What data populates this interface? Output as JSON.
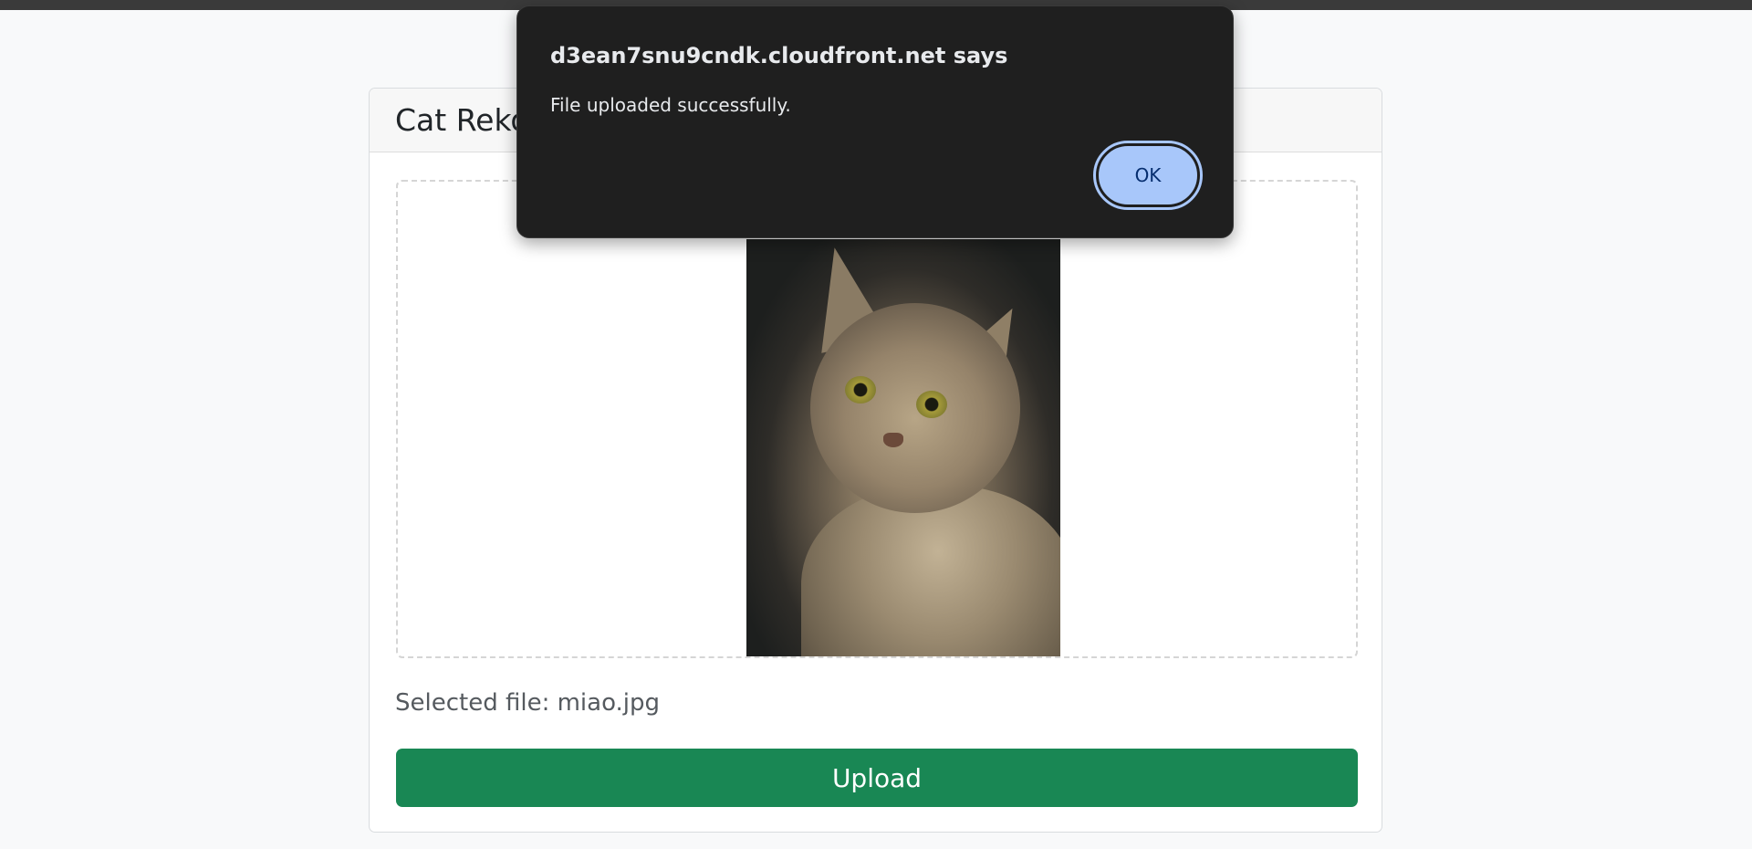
{
  "page": {
    "card_title": "Cat Reko",
    "selected_file": "Selected file: miao.jpg",
    "upload_label": "Upload"
  },
  "preview": {
    "description_icon": "cat-photo"
  },
  "dialog": {
    "title": "d3ean7snu9cndk.cloudfront.net says",
    "message": "File uploaded successfully.",
    "ok_label": "OK"
  },
  "colors": {
    "upload_button": "#198754",
    "dialog_background": "#1f1f1f",
    "ok_button": "#a8c7fa"
  }
}
